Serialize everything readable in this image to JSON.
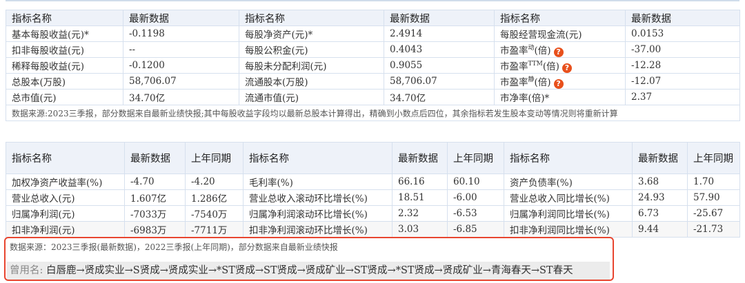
{
  "table1": {
    "headers": [
      "指标名称",
      "最新数据",
      "指标名称",
      "最新数据",
      "指标名称",
      "最新数据"
    ],
    "rows": [
      [
        "基本每股收益(元)*",
        "-0.1198",
        "每股净资产(元)*",
        "2.4914",
        "每股经营现金流(元)",
        "0.0153"
      ],
      [
        "扣非每股收益(元)",
        "--",
        "每股公积金(元)",
        "0.4043",
        "市盈率",
        "-37.00"
      ],
      [
        "稀释每股收益(元)",
        "-0.1200",
        "每股未分配利润(元)",
        "0.9055",
        "市盈率",
        "-12.28"
      ],
      [
        "总股本(万股)",
        "58,706.07",
        "流通股本(万股)",
        "58,706.07",
        "市盈率",
        "-12.07"
      ],
      [
        "总市值(元)",
        "34.70亿",
        "流通市值(元)",
        "34.70亿",
        "市净率(倍)*",
        "2.37"
      ]
    ],
    "pe_variants": [
      {
        "sup": "动",
        "suffix": "(倍)"
      },
      {
        "sup": "TTM",
        "suffix": "(倍)"
      },
      {
        "sup": "静",
        "suffix": "(倍)"
      }
    ],
    "help_glyph": "?",
    "note": "数据来源:2023三季报，部分数据来自最新业绩快报;其中每股收益字段均以最新总股本计算得出，精确到小数点后四位，其余指标若发生股本变动等情况则将重新计算"
  },
  "table2": {
    "headers": [
      "指标名称",
      "最新数据",
      "上年同期",
      "指标名称",
      "最新数据",
      "上年同期",
      "指标名称",
      "最新数据",
      "上年同期"
    ],
    "rows": [
      [
        "加权净资产收益率(%)",
        "-4.70",
        "-4.20",
        "毛利率(%)",
        "66.16",
        "60.10",
        "资产负债率(%)",
        "3.68",
        "1.70"
      ],
      [
        "营业总收入(元)",
        "1.607亿",
        "1.286亿",
        "营业总收入滚动环比增长(%)",
        "18.51",
        "-6.00",
        "营业总收入同比增长(%)",
        "24.93",
        "57.90"
      ],
      [
        "归属净利润(元)",
        "-7033万",
        "-7540万",
        "归属净利润滚动环比增长(%)",
        "2.32",
        "-6.53",
        "归属净利润同比增长(%)",
        "6.73",
        "-25.67"
      ],
      [
        "扣非净利润(元)",
        "-6983万",
        "-7711万",
        "扣非净利润滚动环比增长(%)",
        "3.03",
        "-6.85",
        "扣非净利润同比增长(%)",
        "9.44",
        "-21.73"
      ]
    ],
    "note": "数据来源：2023三季报(最新数据)，2022三季报(上年同期)，部分数据来自最新业绩快报"
  },
  "history": {
    "label": "曾用名:",
    "names": "白唇鹿→贤成实业→S贤成→贤成实业→*ST贤成→ST贤成→贤成矿业→ST贤成→*ST贤成→贤成矿业→青海春天→ST春天"
  },
  "colors": {
    "header_bg": "#eef2f9",
    "border": "#d6e0ee",
    "help_icon": "#e8501c",
    "highlight_box": "#e8452f"
  }
}
